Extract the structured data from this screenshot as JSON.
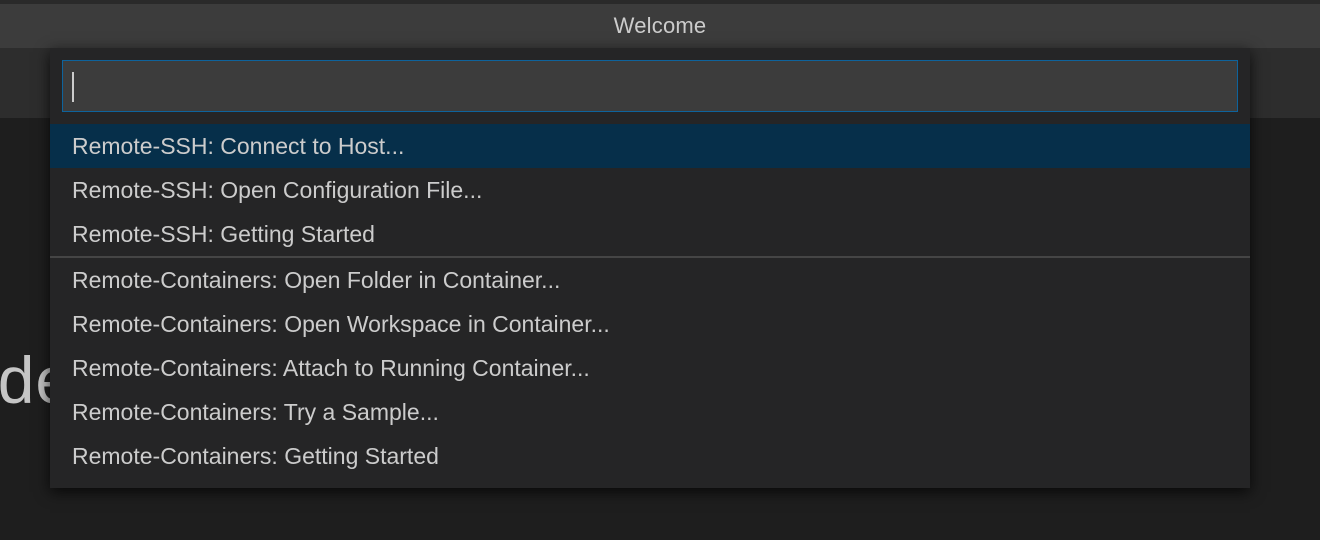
{
  "window": {
    "title": "Welcome"
  },
  "background": {
    "heading_fragment": "ode"
  },
  "quick_open": {
    "input_value": "",
    "groups": [
      {
        "items": [
          {
            "label": "Remote-SSH: Connect to Host...",
            "selected": true
          },
          {
            "label": "Remote-SSH: Open Configuration File...",
            "selected": false
          },
          {
            "label": "Remote-SSH: Getting Started",
            "selected": false
          }
        ]
      },
      {
        "items": [
          {
            "label": "Remote-Containers: Open Folder in Container...",
            "selected": false
          },
          {
            "label": "Remote-Containers: Open Workspace in Container...",
            "selected": false
          },
          {
            "label": "Remote-Containers: Attach to Running Container...",
            "selected": false
          },
          {
            "label": "Remote-Containers: Try a Sample...",
            "selected": false
          },
          {
            "label": "Remote-Containers: Getting Started",
            "selected": false
          }
        ]
      }
    ]
  },
  "colors": {
    "selection_background": "#062f4a",
    "input_border": "#0e639c",
    "widget_background": "#252526",
    "text": "#cccccc"
  }
}
